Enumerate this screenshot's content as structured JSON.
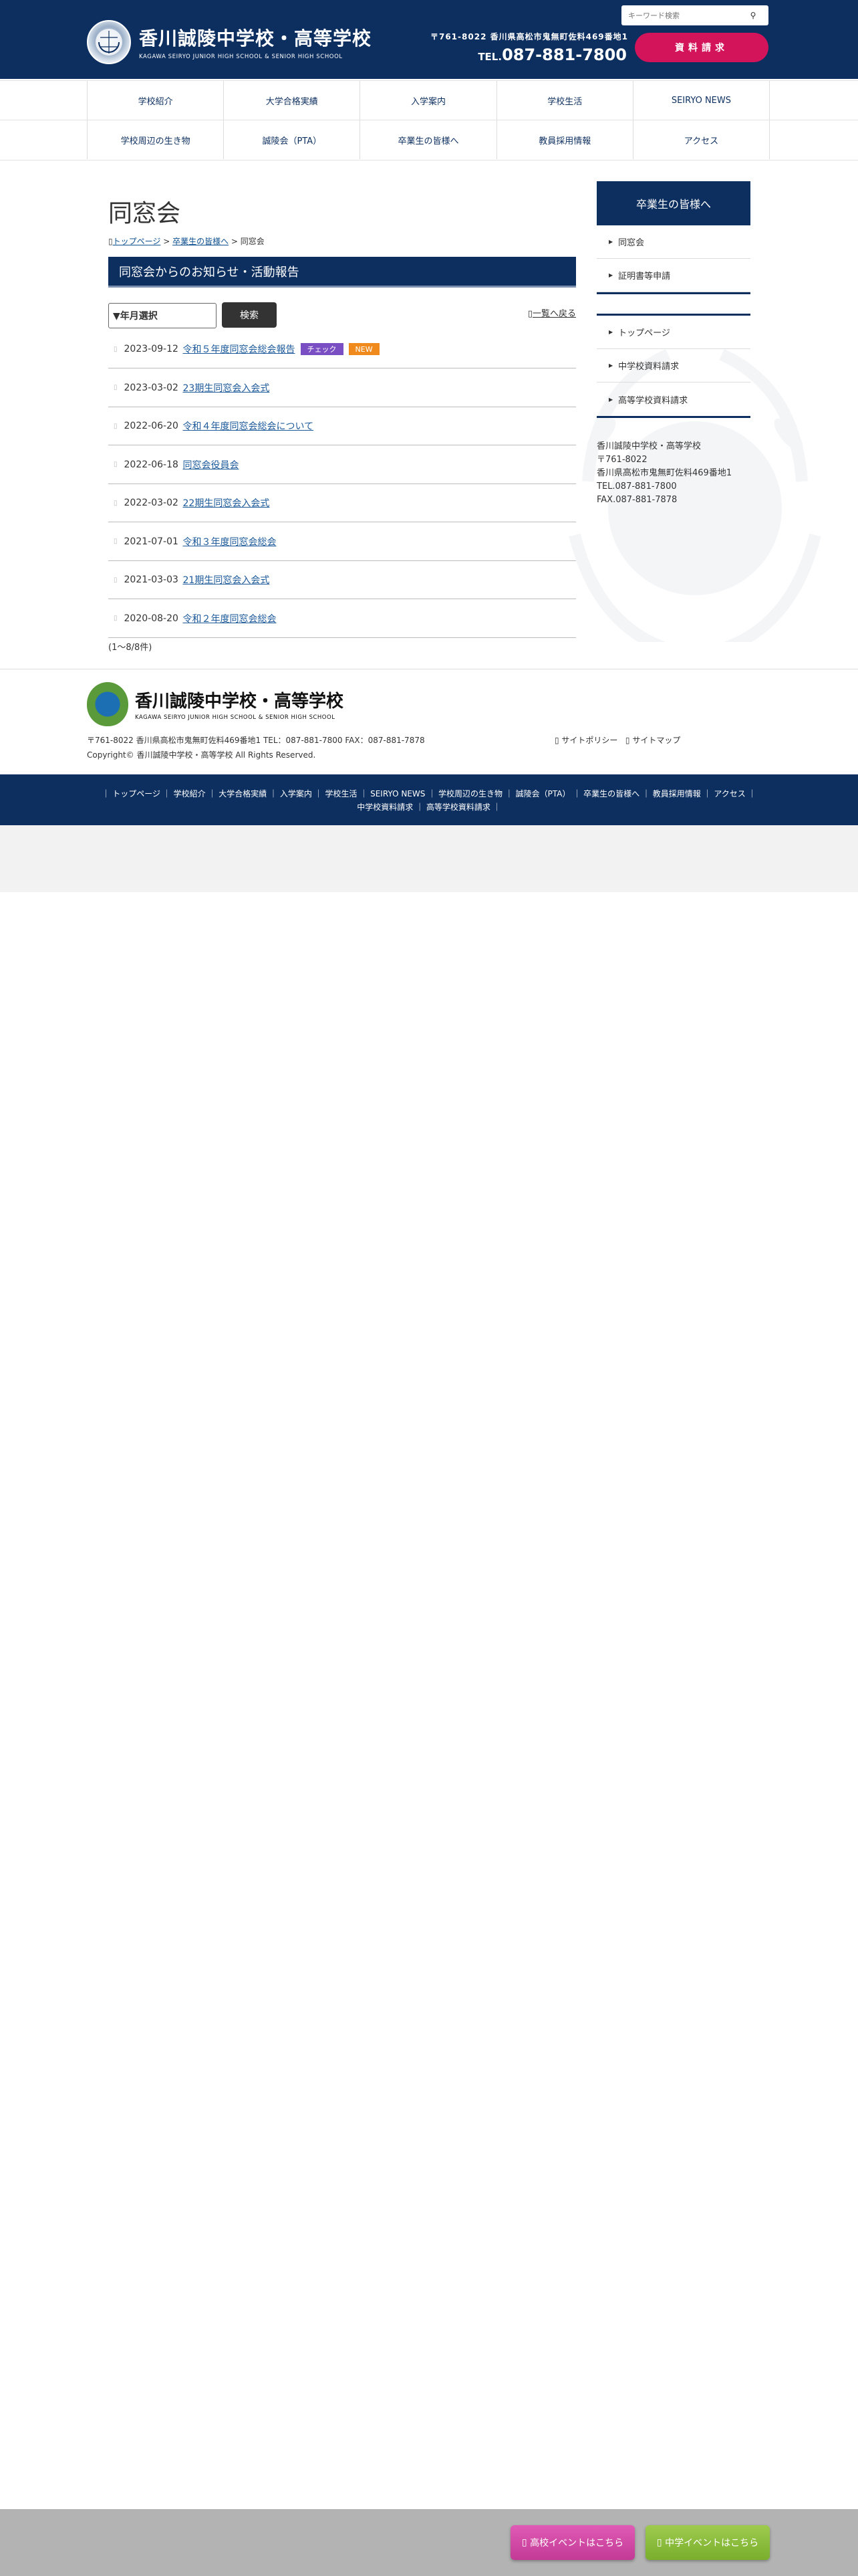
{
  "header": {
    "school_name": "香川誠陵中学校・高等学校",
    "school_name_en": "KAGAWA SEIRYO JUNIOR HIGH SCHOOL & SENIOR HIGH SCHOOL",
    "search_placeholder": "キーワード検索",
    "address": "〒761-8022 香川県高松市鬼無町佐料469番地1",
    "tel_label": "TEL.",
    "tel": "087-881-7800",
    "doc_request": "資料請求"
  },
  "nav": {
    "row1": [
      "学校紹介",
      "大学合格実績",
      "入学案内",
      "学校生活",
      "SEIRYO NEWS"
    ],
    "row2": [
      "学校周辺の生き物",
      "誠陵会（PTA）",
      "卒業生の皆様へ",
      "教員採用情報",
      "アクセス"
    ]
  },
  "main": {
    "page_title": "同窓会",
    "breadcrumb": {
      "home": "トップページ",
      "parent": "卒業生の皆様へ",
      "current": "同窓会",
      "sep": " > "
    },
    "section_title": "同窓会からのお知らせ・活動報告",
    "year_select": "▼年月選択",
    "search_button": "検索",
    "back_link": "一覧へ戻る",
    "news": [
      {
        "date": "2023-09-12",
        "title": "令和５年度同窓会総会報告",
        "badges": [
          "チェック",
          "NEW"
        ]
      },
      {
        "date": "2023-03-02",
        "title": "23期生同窓会入会式",
        "badges": []
      },
      {
        "date": "2022-06-20",
        "title": "令和４年度同窓会総会について",
        "badges": []
      },
      {
        "date": "2022-06-18",
        "title": "同窓会役員会",
        "badges": []
      },
      {
        "date": "2022-03-02",
        "title": "22期生同窓会入会式",
        "badges": []
      },
      {
        "date": "2021-07-01",
        "title": "令和３年度同窓会総会",
        "badges": []
      },
      {
        "date": "2021-03-03",
        "title": "21期生同窓会入会式",
        "badges": []
      },
      {
        "date": "2020-08-20",
        "title": "令和２年度同窓会総会",
        "badges": []
      }
    ],
    "count": "(1～8/8件)"
  },
  "sidebar": {
    "head": "卒業生の皆様へ",
    "group1": [
      "同窓会",
      "証明書等申請"
    ],
    "group2": [
      "トップページ",
      "中学校資料請求",
      "高等学校資料請求"
    ],
    "info": [
      "香川誠陵中学校・高等学校",
      "〒761-8022",
      "香川県高松市鬼無町佐料469番地1",
      "TEL.087-881-7800",
      "FAX.087-881-7878"
    ]
  },
  "footer": {
    "school_name": "香川誠陵中学校・高等学校",
    "school_name_en": "KAGAWA SEIRYO JUNIOR HIGH SCHOOL & SENIOR HIGH SCHOOL",
    "address": "〒761-8022 香川県高松市鬼無町佐料469番地1 TEL：087-881-7800  FAX：087-881-7878",
    "copyright": "Copyright© 香川誠陵中学校・高等学校 All Rights Reserved.",
    "privacy": "サイトポリシー",
    "sitemap": "サイトマップ",
    "nav_line1": "｜ トップページ ｜ 学校紹介 ｜ 大学合格実績 ｜ 入学案内 ｜ 学校生活 ｜ SEIRYO NEWS ｜ 学校周辺の生き物 ｜ 誠陵会（PTA） ｜ 卒業生の皆様へ ｜ 教員採用情報 ｜ アクセス ｜",
    "nav_line2": "中学校資料請求 ｜ 高等学校資料請求 ｜"
  },
  "bottom_bar": {
    "high_event": "高校イベントはこちら",
    "mid_event": "中学イベントはこちら"
  },
  "colors": {
    "navy": "#0d2f5f",
    "pink": "#d4145a",
    "check_badge": "#7b4fc4",
    "new_badge": "#f08a1c"
  }
}
